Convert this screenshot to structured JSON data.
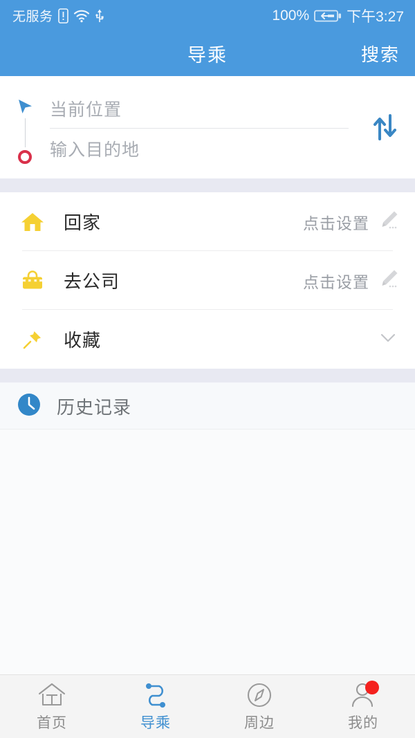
{
  "status_bar": {
    "carrier": "无服务",
    "battery_percent": "100%",
    "time": "下午3:27",
    "icons": [
      "sim-card-icon",
      "wifi-icon",
      "usb-icon",
      "battery-charging-icon"
    ]
  },
  "title_bar": {
    "title": "导乘",
    "action_label": "搜索"
  },
  "route_panel": {
    "origin_placeholder": "当前位置",
    "origin_value": "",
    "destination_placeholder": "输入目的地",
    "destination_value": "",
    "swap_icon": "swap-vertical-icon",
    "origin_icon": "navigation-arrow-icon",
    "destination_icon": "destination-ring-icon"
  },
  "shortcuts": [
    {
      "id": "home",
      "label": "回家",
      "hint": "点击设置",
      "icon": "house-icon",
      "icon_color": "#f5d033",
      "action_icon": "pencil-icon"
    },
    {
      "id": "company",
      "label": "去公司",
      "hint": "点击设置",
      "icon": "briefcase-icon",
      "icon_color": "#f5d033",
      "action_icon": "pencil-icon"
    },
    {
      "id": "favorites",
      "label": "收藏",
      "hint": "",
      "icon": "pushpin-icon",
      "icon_color": "#f5d033",
      "action_icon": "chevron-down-icon"
    }
  ],
  "history": {
    "label": "历史记录",
    "icon": "clock-icon",
    "items": []
  },
  "bottom_nav": {
    "items": [
      {
        "id": "home",
        "label": "首页",
        "icon": "house-outline-icon",
        "active": false,
        "badge": false
      },
      {
        "id": "transit",
        "label": "导乘",
        "icon": "route-curve-icon",
        "active": true,
        "badge": false
      },
      {
        "id": "nearby",
        "label": "周边",
        "icon": "compass-icon",
        "active": false,
        "badge": false
      },
      {
        "id": "mine",
        "label": "我的",
        "icon": "person-icon",
        "active": false,
        "badge": true
      }
    ]
  },
  "colors": {
    "brand_blue": "#4a9ade",
    "accent_blue": "#3f8fd0",
    "marker_red": "#d9304a",
    "icon_yellow": "#f5d033",
    "badge_red": "#f4211e",
    "divider": "#e8e9f2"
  }
}
